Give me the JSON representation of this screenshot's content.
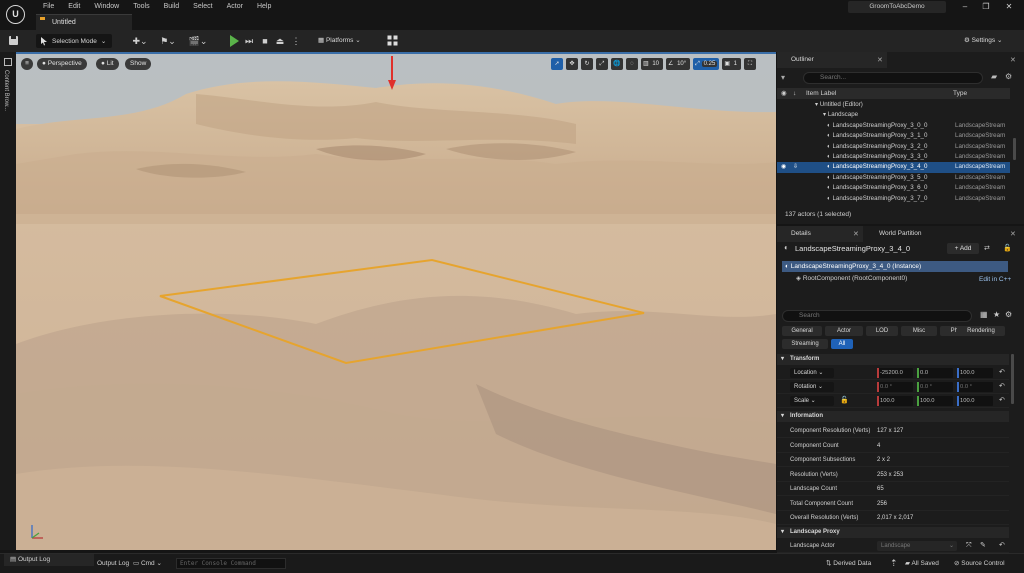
{
  "window": {
    "logo": "U",
    "menu": [
      "File",
      "Edit",
      "Window",
      "Tools",
      "Build",
      "Select",
      "Actor",
      "Help"
    ],
    "document_tab": "Untitled",
    "project_name": "GroomToAbcDemo"
  },
  "toolbar": {
    "selection_mode": "Selection Mode",
    "platforms": "Platforms",
    "settings": "Settings"
  },
  "left_strip": {
    "content_browser": "Content Brow..."
  },
  "viewport": {
    "view_mode": "Perspective",
    "lighting": "Lit",
    "show": "Show",
    "grid_snap": "10",
    "rotation_snap": "10°",
    "scale_snap": "0.25",
    "camera_speed": "1"
  },
  "outliner": {
    "tab_label": "Outliner",
    "search_placeholder": "Search...",
    "col_label": "Item Label",
    "col_type": "Type",
    "rows": [
      {
        "label": "Untitled (Editor)",
        "type": ""
      },
      {
        "label": "Landscape",
        "type": ""
      },
      {
        "label": "LandscapeStreamingProxy_3_0_0",
        "type": "LandscapeStream"
      },
      {
        "label": "LandscapeStreamingProxy_3_1_0",
        "type": "LandscapeStream"
      },
      {
        "label": "LandscapeStreamingProxy_3_2_0",
        "type": "LandscapeStream"
      },
      {
        "label": "LandscapeStreamingProxy_3_3_0",
        "type": "LandscapeStream"
      },
      {
        "label": "LandscapeStreamingProxy_3_4_0",
        "type": "LandscapeStream"
      },
      {
        "label": "LandscapeStreamingProxy_3_5_0",
        "type": "LandscapeStream"
      },
      {
        "label": "LandscapeStreamingProxy_3_6_0",
        "type": "LandscapeStream"
      },
      {
        "label": "LandscapeStreamingProxy_3_7_0",
        "type": "LandscapeStream"
      }
    ],
    "footer": "137 actors (1 selected)"
  },
  "details": {
    "tab_details": "Details",
    "tab_world_partition": "World Partition",
    "actor_name": "LandscapeStreamingProxy_3_4_0",
    "add_label": "+ Add",
    "instance_row": "LandscapeStreamingProxy_3_4_0 (Instance)",
    "root_component": "RootComponent (RootComponent0)",
    "edit_cpp": "Edit in C++",
    "search_placeholder": "Search",
    "filters": [
      "General",
      "Actor",
      "LOD",
      "Misc",
      "Physics",
      "Rendering",
      "Streaming",
      "All"
    ],
    "transform_header": "Transform",
    "location_label": "Location",
    "location": [
      "-25200.0",
      "0.0",
      "100.0"
    ],
    "rotation_label": "Rotation",
    "rotation": [
      "0.0 °",
      "0.0 °",
      "0.0 °"
    ],
    "scale_label": "Scale",
    "scale": [
      "100.0",
      "100.0",
      "100.0"
    ],
    "information_header": "Information",
    "info": [
      {
        "label": "Component Resolution (Verts)",
        "value": "127 x 127"
      },
      {
        "label": "Component Count",
        "value": "4"
      },
      {
        "label": "Component Subsections",
        "value": "2 x 2"
      },
      {
        "label": "Resolution (Verts)",
        "value": "253 x 253"
      },
      {
        "label": "Landscape Count",
        "value": "65"
      },
      {
        "label": "Total Component Count",
        "value": "256"
      },
      {
        "label": "Overall Resolution (Verts)",
        "value": "2,017 x 2,017"
      }
    ],
    "landscape_proxy_header": "Landscape Proxy",
    "landscape_actor_label": "Landscape Actor",
    "landscape_actor_value": "Landscape"
  },
  "statusbar": {
    "content_drawer": "Output Log",
    "output_log": "Output Log",
    "cmd": "Cmd",
    "cmd_placeholder": "Enter Console Command",
    "derived_data": "Derived Data",
    "all_saved": "All Saved",
    "source_control": "Source Control"
  },
  "colors": {
    "accent_blue": "#1f62b8",
    "selection_box": "#e6a42e",
    "play_green": "#5ab34a",
    "marker_red": "#e0302a"
  }
}
